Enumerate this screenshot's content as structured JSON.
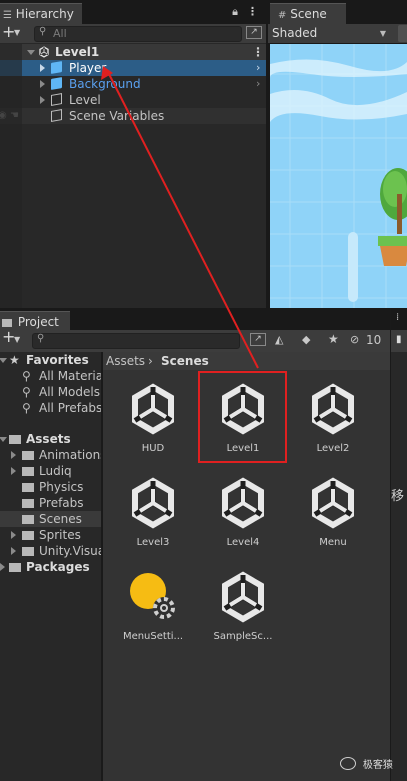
{
  "hierarchy": {
    "tab_label": "Hierarchy",
    "search_placeholder": "All",
    "scene_name": "Level1",
    "items": [
      {
        "label": "Player",
        "color": "#ffffff"
      },
      {
        "label": "Background",
        "color": "#5aa0ef"
      },
      {
        "label": "Level",
        "color": "#c4c4c4"
      },
      {
        "label": "Scene Variables",
        "color": "#c4c4c4"
      }
    ]
  },
  "scene": {
    "tab_label": "Scene",
    "shading_mode": "Shaded",
    "sky_color": "#8fd3f8"
  },
  "project": {
    "tab_label": "Project",
    "hidden_count": "10",
    "breadcrumb": {
      "root": "Assets",
      "current": "Scenes"
    },
    "favorites": {
      "label": "Favorites",
      "items": [
        "All Materia",
        "All Models",
        "All Prefabs"
      ]
    },
    "assets_tree": {
      "label": "Assets",
      "folders": [
        "Animations",
        "Ludiq",
        "Physics",
        "Prefabs",
        "Scenes",
        "Sprites",
        "Unity.Visua"
      ]
    },
    "packages_label": "Packages",
    "asset_items": [
      {
        "label": "HUD",
        "icon": "unity-scene-icon"
      },
      {
        "label": "Level1",
        "icon": "unity-scene-icon",
        "highlighted": true
      },
      {
        "label": "Level2",
        "icon": "unity-scene-icon"
      },
      {
        "label": "Level3",
        "icon": "unity-scene-icon"
      },
      {
        "label": "Level4",
        "icon": "unity-scene-icon"
      },
      {
        "label": "Menu",
        "icon": "unity-scene-icon"
      },
      {
        "label": "MenuSetti...",
        "icon": "lighting-settings-icon"
      },
      {
        "label": "SampleSc...",
        "icon": "unity-scene-icon"
      }
    ]
  },
  "side_panel_text": "移",
  "watermark": "极客猿",
  "colors": {
    "selection": "#2c5d87",
    "annotation": "#e02020"
  }
}
